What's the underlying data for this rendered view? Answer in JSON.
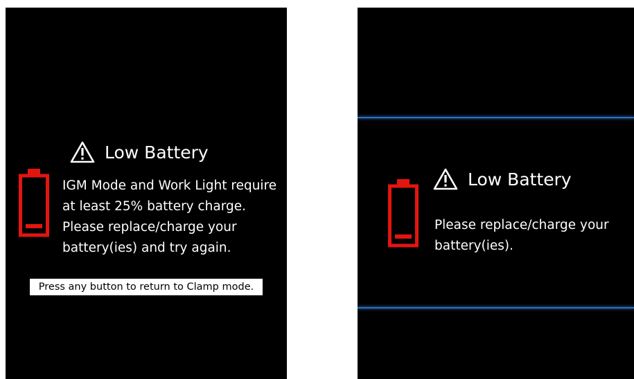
{
  "left_screen": {
    "title": "Low Battery",
    "message_lines": [
      "IGM Mode and Work Light require",
      "at least 25% battery charge.",
      "Please replace/charge your",
      "battery(ies) and try again."
    ],
    "hint": "Press any button to return to Clamp mode.",
    "icons": {
      "warning": "warning-triangle-icon",
      "battery": "battery-low-icon"
    }
  },
  "right_screen": {
    "title": "Low Battery",
    "message_lines": [
      "Please replace/charge your",
      "battery(ies)."
    ],
    "icons": {
      "warning": "warning-triangle-icon",
      "battery": "battery-low-icon"
    }
  },
  "colors": {
    "screen_background": "#000000",
    "text": "#ffffff",
    "battery_alert": "#e3150f",
    "accent_line": "#2d6fc0"
  }
}
